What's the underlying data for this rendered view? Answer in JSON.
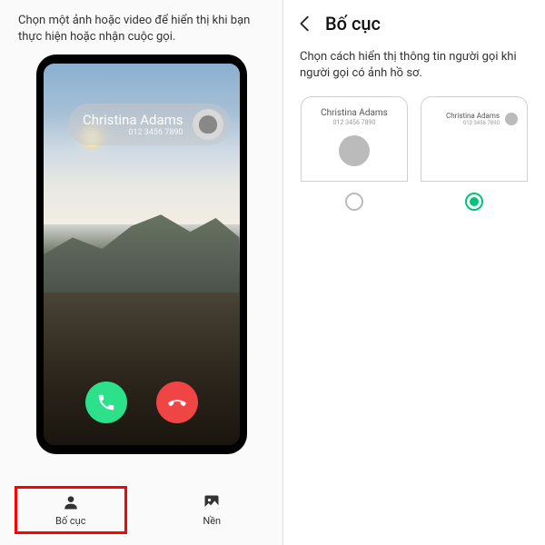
{
  "leftPane": {
    "introText": "Chọn một ảnh hoặc video để hiển thị khi bạn thực hiện hoặc nhận cuộc gọi.",
    "caller": {
      "name": "Christina Adams",
      "number": "012 3456 7890"
    },
    "tabs": {
      "layout": "Bố cục",
      "background": "Nền"
    }
  },
  "rightPane": {
    "headerTitle": "Bố cục",
    "subText": "Chọn cách hiển thị thông tin người gọi khi người gọi có ảnh hồ sơ.",
    "options": {
      "a": {
        "name": "Christina Adams",
        "number": "012 3456 7890",
        "selected": false
      },
      "b": {
        "name": "Christina Adams",
        "number": "012 3456 7890",
        "selected": true
      }
    }
  }
}
